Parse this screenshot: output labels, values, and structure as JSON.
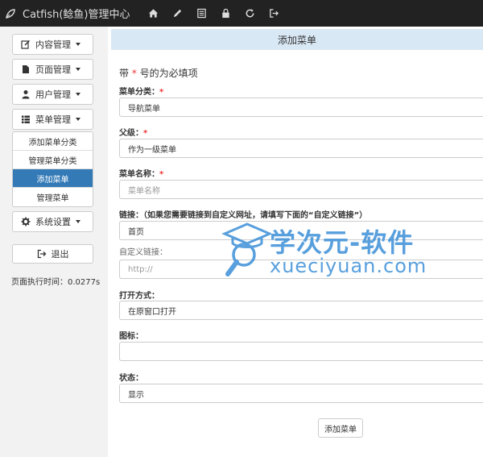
{
  "navbar": {
    "brand": "Catfish(鲶鱼)管理中心",
    "icons": [
      "home-icon",
      "pencil-icon",
      "list-icon",
      "lock-icon",
      "refresh-icon",
      "sign-out-icon"
    ]
  },
  "sidebar": {
    "menus": [
      {
        "label": "内容管理",
        "icon": "edit-icon"
      },
      {
        "label": "页面管理",
        "icon": "file-icon"
      },
      {
        "label": "用户管理",
        "icon": "user-icon"
      },
      {
        "label": "菜单管理",
        "icon": "list-icon"
      }
    ],
    "submenu": [
      {
        "label": "添加菜单分类"
      },
      {
        "label": "管理菜单分类"
      },
      {
        "label": "添加菜单",
        "active": true
      },
      {
        "label": "管理菜单"
      }
    ],
    "settings": {
      "label": "系统设置",
      "icon": "gear-icon"
    },
    "logout": "退出",
    "exec_time": "页面执行时间：0.0277s"
  },
  "main": {
    "header": "添加菜单",
    "required_note_prefix": "带",
    "required_note_star": "*",
    "required_note_suffix": "号的为必填项",
    "fields": {
      "category_label": "菜单分类：",
      "category_value": "导航菜单",
      "parent_label": "父级：",
      "parent_value": "作为一级菜单",
      "name_label": "菜单名称：",
      "name_placeholder": "菜单名称",
      "link_label": "链接：（如果您需要链接到自定义网址，请填写下面的“自定义链接”）",
      "link_value": "首页",
      "custom_link_label": "自定义链接：",
      "custom_link_placeholder": "http://",
      "open_mode_label": "打开方式：",
      "open_mode_value": "在原窗口打开",
      "icon_label": "图标：",
      "icon_value": "",
      "status_label": "状态：",
      "status_value": "显示"
    },
    "required_star": "*",
    "submit": "添加菜单"
  },
  "watermark": {
    "text": "学次元-软件",
    "url": "xueciyuan.com",
    "color": "#3b8fd8"
  }
}
